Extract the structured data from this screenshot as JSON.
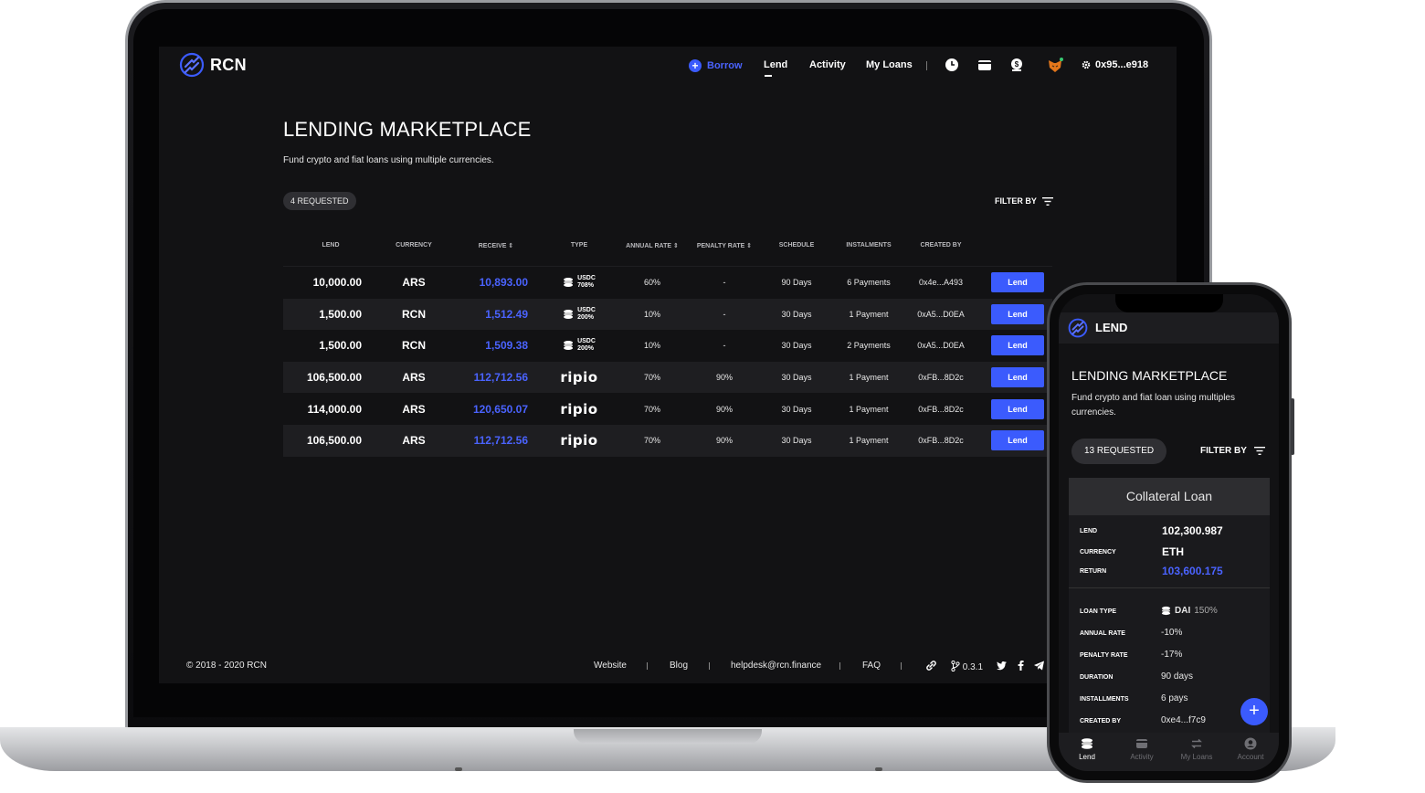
{
  "brand": {
    "name": "RCN",
    "accent": "#3b5bfd",
    "link_blue": "#4a63ff"
  },
  "nav": {
    "borrow": "Borrow",
    "lend": "Lend",
    "activity": "Activity",
    "my_loans": "My Loans",
    "icons": [
      "clock-icon",
      "wallet-icon",
      "dollar-bag-icon",
      "metamask-fox-icon"
    ],
    "address": "0x95...e918"
  },
  "page": {
    "title": "LENDING MARKETPLACE",
    "subtitle": "Fund crypto and fiat loans using multiple currencies.",
    "requested": "4 REQUESTED",
    "filter": "FILTER BY"
  },
  "table": {
    "headers": {
      "lend": "LEND",
      "currency": "CURRENCY",
      "receive": "RECEIVE",
      "type": "TYPE",
      "annual_rate": "ANNUAL RATE",
      "penalty_rate": "PENALTY RATE",
      "schedule": "SCHEDULE",
      "instalments": "INSTALMENTS",
      "created_by": "CREATED BY"
    },
    "rows": [
      {
        "lend": "10,000.00",
        "currency": "ARS",
        "receive": "10,893.00",
        "type": "usdc",
        "type_label": "USDC",
        "type_pct": "708%",
        "annual": "60%",
        "penalty": "-",
        "schedule": "90 Days",
        "instalments": "6 Payments",
        "created_by": "0x4e...A493",
        "action": "Lend"
      },
      {
        "lend": "1,500.00",
        "currency": "RCN",
        "receive": "1,512.49",
        "type": "usdc",
        "type_label": "USDC",
        "type_pct": "200%",
        "annual": "10%",
        "penalty": "-",
        "schedule": "30 Days",
        "instalments": "1 Payment",
        "created_by": "0xA5...D0EA",
        "action": "Lend"
      },
      {
        "lend": "1,500.00",
        "currency": "RCN",
        "receive": "1,509.38",
        "type": "usdc",
        "type_label": "USDC",
        "type_pct": "200%",
        "annual": "10%",
        "penalty": "-",
        "schedule": "30 Days",
        "instalments": "2 Payments",
        "created_by": "0xA5...D0EA",
        "action": "Lend"
      },
      {
        "lend": "106,500.00",
        "currency": "ARS",
        "receive": "112,712.56",
        "type": "ripio",
        "type_label": "ripio",
        "type_pct": "",
        "annual": "70%",
        "penalty": "90%",
        "schedule": "30 Days",
        "instalments": "1 Payment",
        "created_by": "0xFB...8D2c",
        "action": "Lend"
      },
      {
        "lend": "114,000.00",
        "currency": "ARS",
        "receive": "120,650.07",
        "type": "ripio",
        "type_label": "ripio",
        "type_pct": "",
        "annual": "70%",
        "penalty": "90%",
        "schedule": "30 Days",
        "instalments": "1 Payment",
        "created_by": "0xFB...8D2c",
        "action": "Lend"
      },
      {
        "lend": "106,500.00",
        "currency": "ARS",
        "receive": "112,712.56",
        "type": "ripio",
        "type_label": "ripio",
        "type_pct": "",
        "annual": "70%",
        "penalty": "90%",
        "schedule": "30 Days",
        "instalments": "1 Payment",
        "created_by": "0xFB...8D2c",
        "action": "Lend"
      }
    ]
  },
  "footer": {
    "copyright": "© 2018 - 2020 RCN",
    "website": "Website",
    "blog": "Blog",
    "email": "helpdesk@rcn.finance",
    "faq": "FAQ",
    "version": "0.3.1"
  },
  "mobile": {
    "header": "LEND",
    "title": "LENDING MARKETPLACE",
    "subtitle": "Fund crypto and fiat loan using multiples currencies.",
    "requested": "13 REQUESTED",
    "filter": "FILTER BY",
    "card": {
      "title": "Collateral Loan",
      "lend_label": "LEND",
      "lend": "102,300.987",
      "currency_label": "CURRENCY",
      "currency": "ETH",
      "return_label": "RETURN",
      "return": "103,600.175",
      "loan_type_label": "LOAN TYPE",
      "loan_type": "DAI",
      "loan_type_pct": "150%",
      "annual_label": "ANNUAL RATE",
      "annual": "-10%",
      "penalty_label": "PENALTY RATE",
      "penalty": "-17%",
      "duration_label": "DURATION",
      "duration": "90 days",
      "installments_label": "INSTALLMENTS",
      "installments": "6 pays",
      "created_label": "CREATED BY",
      "created": "0xe4...f7c9"
    },
    "tabs": [
      "Lend",
      "Activity",
      "My Loans",
      "Account"
    ]
  }
}
